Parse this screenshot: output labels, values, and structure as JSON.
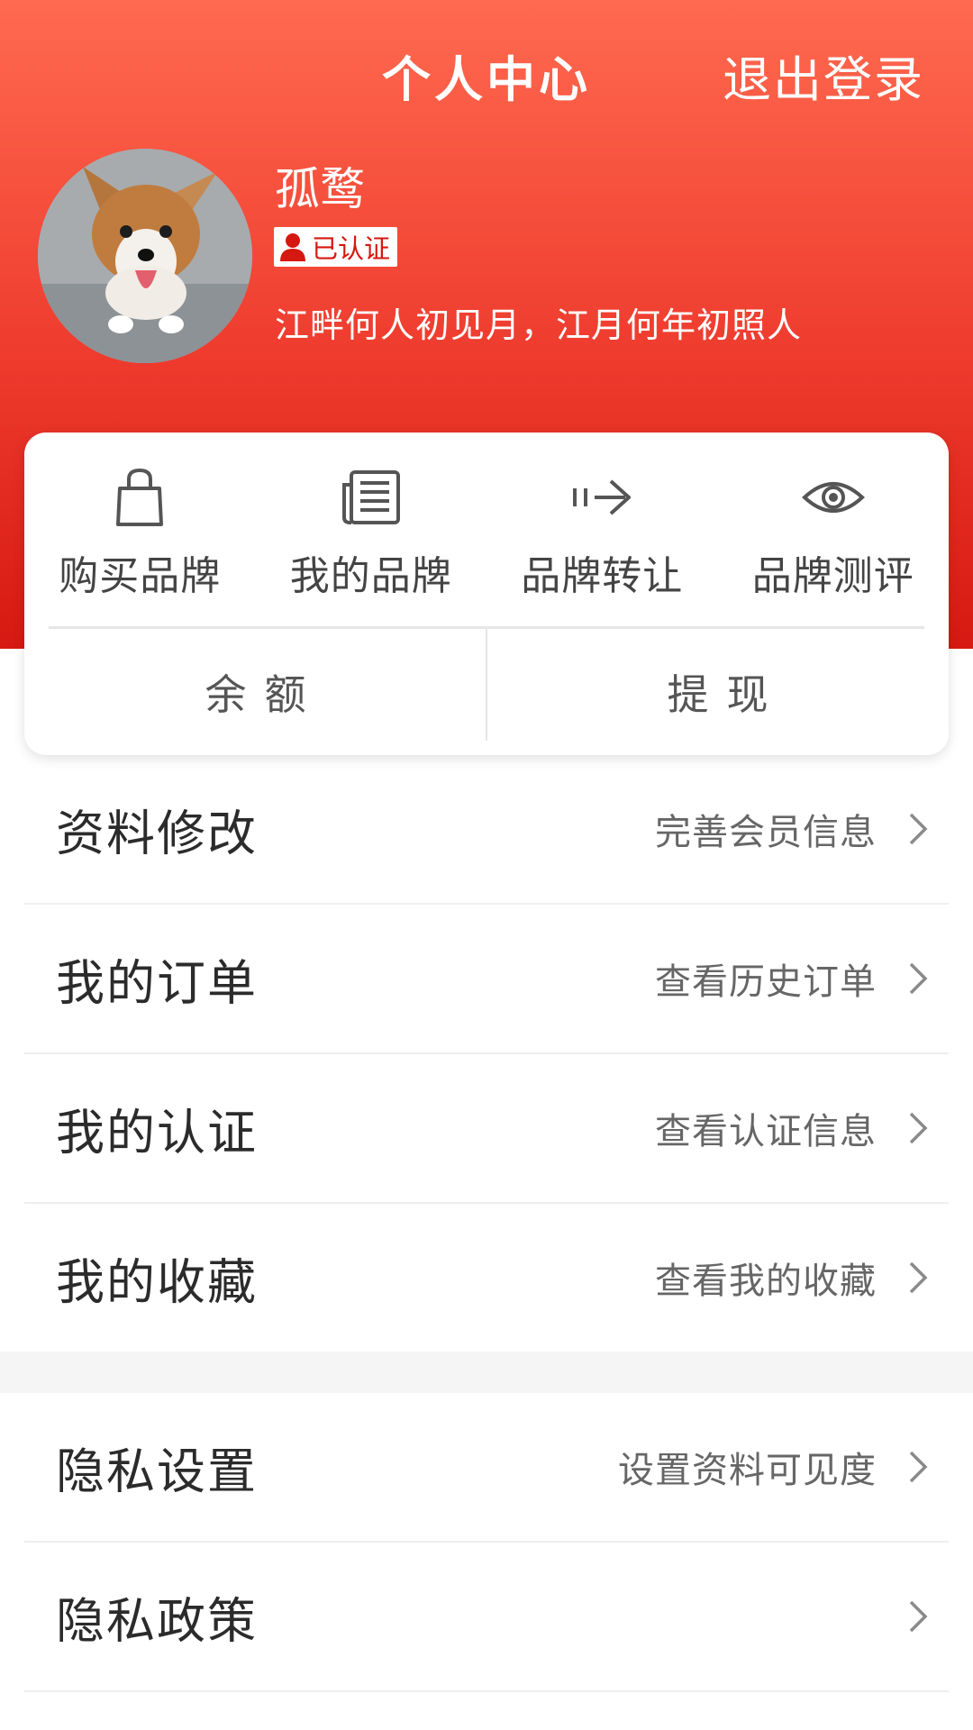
{
  "header": {
    "title": "个人中心",
    "logout_label": "退出登录"
  },
  "profile": {
    "username": "孤鹜",
    "verified_label": "已认证",
    "bio": "江畔何人初见月，江月何年初照人"
  },
  "quick_actions": [
    {
      "label": "购买品牌",
      "icon": "shopping-bag-icon"
    },
    {
      "label": "我的品牌",
      "icon": "news-list-icon"
    },
    {
      "label": "品牌转让",
      "icon": "transfer-arrow-icon"
    },
    {
      "label": "品牌测评",
      "icon": "eye-icon"
    }
  ],
  "balance": {
    "balance_label": "余额",
    "withdraw_label": "提现"
  },
  "menu": {
    "items": [
      {
        "label": "资料修改",
        "hint": "完善会员信息"
      },
      {
        "label": "我的订单",
        "hint": "查看历史订单"
      },
      {
        "label": "我的认证",
        "hint": "查看认证信息"
      },
      {
        "label": "我的收藏",
        "hint": "查看我的收藏"
      }
    ],
    "items2": [
      {
        "label": "隐私设置",
        "hint": "设置资料可见度"
      },
      {
        "label": "隐私政策",
        "hint": ""
      }
    ]
  },
  "colors": {
    "header_top": "#ff6a50",
    "header_bottom": "#d61912",
    "badge_text": "#d51810"
  }
}
